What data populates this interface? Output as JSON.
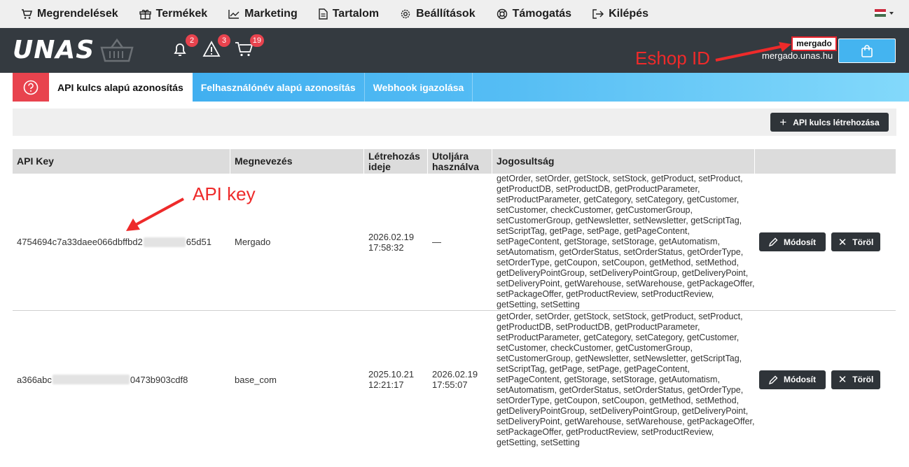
{
  "topmenu": {
    "items": [
      {
        "label": "Megrendelések",
        "icon": "cart-icon"
      },
      {
        "label": "Termékek",
        "icon": "box-icon"
      },
      {
        "label": "Marketing",
        "icon": "chart-icon"
      },
      {
        "label": "Tartalom",
        "icon": "document-icon"
      },
      {
        "label": "Beállítások",
        "icon": "gear-icon"
      },
      {
        "label": "Támogatás",
        "icon": "lifebuoy-icon"
      },
      {
        "label": "Kilépés",
        "icon": "logout-icon"
      }
    ],
    "language_flag": "hu-flag-icon"
  },
  "header": {
    "logo_text": "UNAS",
    "notifications_count": "2",
    "warnings_count": "3",
    "orders_count": "19",
    "shop_id": "mergado",
    "shop_domain": "mergado.unas.hu"
  },
  "annotations": {
    "eshop_id_label": "Eshop ID",
    "api_key_label": "API key"
  },
  "tabs": [
    {
      "label": "API kulcs alapú azonosítás",
      "active": true
    },
    {
      "label": "Felhasználónév alapú azonosítás",
      "active": false
    },
    {
      "label": "Webhook igazolása",
      "active": false
    }
  ],
  "toolbar": {
    "create_label": "API kulcs létrehozása"
  },
  "table": {
    "headers": [
      "API Key",
      "Megnevezés",
      "Létrehozás ideje",
      "Utoljára használva",
      "Jogosultság",
      ""
    ],
    "rows": [
      {
        "key_start": "4754694c7a33daee066dbffbd2",
        "key_end": "65d51",
        "name": "Mergado",
        "created": "2026.02.19 17:58:32",
        "last_used": "—",
        "permissions": "getOrder, setOrder, getStock, setStock, getProduct, setProduct, getProductDB, setProductDB, getProductParameter, setProductParameter, getCategory, setCategory, getCustomer, setCustomer, checkCustomer, getCustomerGroup, setCustomerGroup, getNewsletter, setNewsletter, getScriptTag, setScriptTag, getPage, setPage, getPageContent, setPageContent, getStorage, setStorage, getAutomatism, setAutomatism, getOrderStatus, setOrderStatus, getOrderType, setOrderType, getCoupon, setCoupon, getMethod, setMethod, getDeliveryPointGroup, setDeliveryPointGroup, getDeliveryPoint, setDeliveryPoint, getWarehouse, setWarehouse, getPackageOffer, setPackageOffer, getProductReview, setProductReview, getSetting, setSetting",
        "edit_label": "Módosít",
        "delete_label": "Töröl"
      },
      {
        "key_start": "a366abc",
        "key_end": "0473b903cdf8",
        "name": "base_com",
        "created": "2025.10.21 12:21:17",
        "last_used": "2026.02.19 17:55:07",
        "permissions": "getOrder, setOrder, getStock, setStock, getProduct, setProduct, getProductDB, setProductDB, getProductParameter, setProductParameter, getCategory, setCategory, getCustomer, setCustomer, checkCustomer, getCustomerGroup, setCustomerGroup, getNewsletter, setNewsletter, getScriptTag, setScriptTag, getPage, setPage, getPageContent, setPageContent, getStorage, setStorage, getAutomatism, setAutomatism, getOrderStatus, setOrderStatus, getOrderType, setOrderType, getCoupon, setCoupon, getMethod, setMethod, getDeliveryPointGroup, setDeliveryPointGroup, getDeliveryPoint, setDeliveryPoint, getWarehouse, setWarehouse, getPackageOffer, setPackageOffer, getProductReview, setProductReview, getSetting, setSetting",
        "edit_label": "Módosít",
        "delete_label": "Töröl"
      }
    ]
  },
  "colors": {
    "dark_header": "#343a40",
    "tab_blue": "#35a7ee",
    "help_red": "#e8434e",
    "annotation_red": "#ee2a2a",
    "button_dark": "#2f3439"
  }
}
